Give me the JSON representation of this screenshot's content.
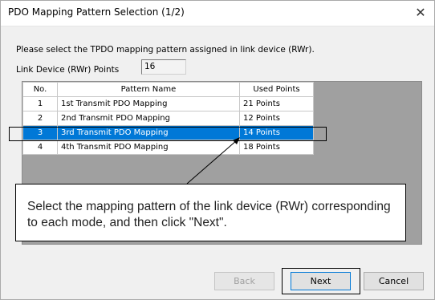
{
  "dialog": {
    "title": "PDO Mapping Pattern Selection (1/2)",
    "close_glyph": "✕",
    "prompt": "Please select the TPDO mapping pattern assigned in link device (RWr).",
    "points_label": "Link Device (RWr) Points",
    "points_value": "16"
  },
  "table": {
    "headers": {
      "no": "No.",
      "name": "Pattern Name",
      "points": "Used Points"
    },
    "rows": [
      {
        "no": "1",
        "name": "1st Transmit PDO Mapping",
        "points": "21 Points"
      },
      {
        "no": "2",
        "name": "2nd Transmit PDO Mapping",
        "points": "12 Points"
      },
      {
        "no": "3",
        "name": "3rd Transmit PDO Mapping",
        "points": "14 Points"
      },
      {
        "no": "4",
        "name": "4th Transmit PDO Mapping",
        "points": "18 Points"
      }
    ],
    "selected_row": 2,
    "selection_color": "#0078d7"
  },
  "callout": {
    "text": "Select the mapping pattern of the link device (RWr) corresponding to each mode, and then click \"Next\"."
  },
  "buttons": {
    "back": "Back",
    "next": "Next",
    "cancel": "Cancel"
  }
}
